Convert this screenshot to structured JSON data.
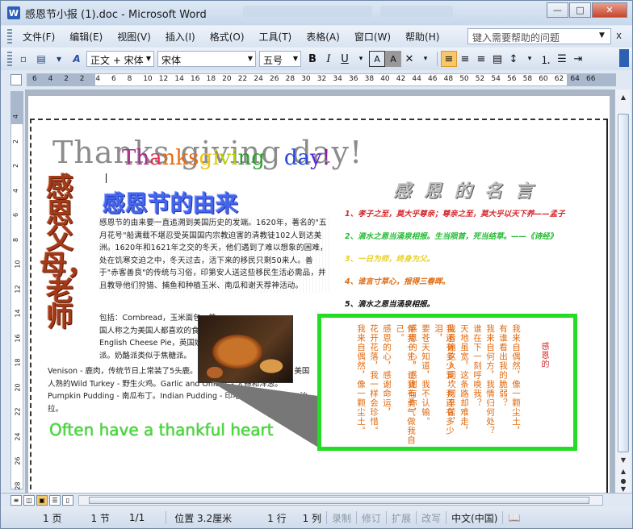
{
  "window": {
    "title": "感恩节小报 (1).doc - Microsoft Word",
    "app_icon": "W",
    "minimize_icon": "—",
    "maximize_icon": "□",
    "close_icon": "✕"
  },
  "menubar": {
    "items": [
      "文件(F)",
      "编辑(E)",
      "视图(V)",
      "插入(I)",
      "格式(O)",
      "工具(T)",
      "表格(A)",
      "窗口(W)",
      "帮助(H)"
    ],
    "help_placeholder": "键入需要帮助的问题",
    "close_doc": "x"
  },
  "toolbar": {
    "style_value": "正文 + 宋体",
    "font_value": "宋体",
    "size_value": "五号",
    "bold": "B",
    "italic": "I",
    "underline": "U"
  },
  "ruler": {
    "numbers": [
      "6",
      "4",
      "2",
      "2",
      "4",
      "6",
      "8",
      "10",
      "12",
      "14",
      "16",
      "18",
      "20",
      "22",
      "24",
      "26",
      "28",
      "30",
      "32",
      "34",
      "36",
      "38",
      "40",
      "42",
      "44",
      "46",
      "48",
      "50",
      "52",
      "54",
      "56",
      "58",
      "60",
      "62",
      "64",
      "66"
    ],
    "vnumbers": [
      "4",
      "2",
      "2",
      "4",
      "6",
      "8",
      "10",
      "12",
      "14",
      "16",
      "18",
      "20",
      "22",
      "24",
      "26",
      "28"
    ]
  },
  "document": {
    "big_english": "Thanks giving day!",
    "wordart_title": [
      "Th",
      "a",
      "nks",
      " g",
      "i",
      "vi",
      "ng",
      " ",
      "da",
      "y",
      "!"
    ],
    "vertical_title": "感恩父母，老师",
    "history_title": "感恩节的由来",
    "history_body": "感恩节的由来要一直追溯到美国历史的发端。1620年，著名的\"五月花号\"船满载不堪忍受英国国内宗教迫害的清教徒102人到达美洲。1620年和1621年之交的冬天，他们遇到了难以想象的困难，处在饥寒交迫之中，冬天过去，活下来的移民只剩50来人。善于\"赤客善良\"的传统与习俗，印第安人送这些移民生活必需品，并且教导他们狩猎、捕鱼和种植玉米、南瓜和谢天荐神活动。",
    "history_body2": "包括：Cornbread，玉米面包、美国人称之为美国人都喜欢的食物。English Cheese Pie，英国奶酪派。奶酪派类似于焦糖派。",
    "history_body3": "Venison - 鹿肉，传统节日上常装了5头鹿。Ducks & Geese - 鸭和鹅，美国人熟的Wild Turkey - 野生火鸡。Garlic and Onions - 大蒜和洋葱。Pumpkin Pudding - 南瓜布丁。Indian Pudding - 印地安布丁。Salad - 沙拉。",
    "thankful": "Often have a thankful heart",
    "quotes_title": "感 恩 的 名 言",
    "quotes": [
      {
        "text": "1、孝子之至，莫大乎尊亲；尊亲之至，莫大乎以天下养——孟子",
        "color": "#d4262a"
      },
      {
        "text": "2、滴水之恩当涌泉相报。生当陨首，死当结草。——《诗经》",
        "color": "#22bb33"
      },
      {
        "text": "3、一日为师，终身为父。",
        "color": "#e8d020"
      },
      {
        "text": "4、谁言寸草心，报得三春晖。",
        "color": "#e06a10"
      },
      {
        "text": "5、滴水之恩当涌泉相报。",
        "color": "#111111"
      }
    ],
    "poem_title": "感恩的",
    "poem_columns": [
      "我来自偶然，像一颗尘土，",
      "有谁看出我的脆弱？",
      "我来自何方，我情归何处？",
      "谁在下一刻呼唤我？",
      "天地虽宽，这条路却难走，",
      "我看遍这人间坎坷辛苦，",
      "我还有多少爱，我还有多少泪，",
      "要苍天知道，我不认输。",
      "感恩的心，感谢有你，",
      "伴我一生，让我有勇气做我自己。",
      "感恩的心，感谢命运，",
      "花开花落，我一样会珍惜。",
      "我来自偶然，像一颗尘土。"
    ]
  },
  "statusbar": {
    "page": "1 页",
    "section": "1 节",
    "pages": "1/1",
    "position": "位置 3.2厘米",
    "line": "1 行",
    "column": "1 列",
    "rec": "录制",
    "trk": "修订",
    "ext": "扩展",
    "ovr": "改写",
    "language": "中文(中国)"
  }
}
